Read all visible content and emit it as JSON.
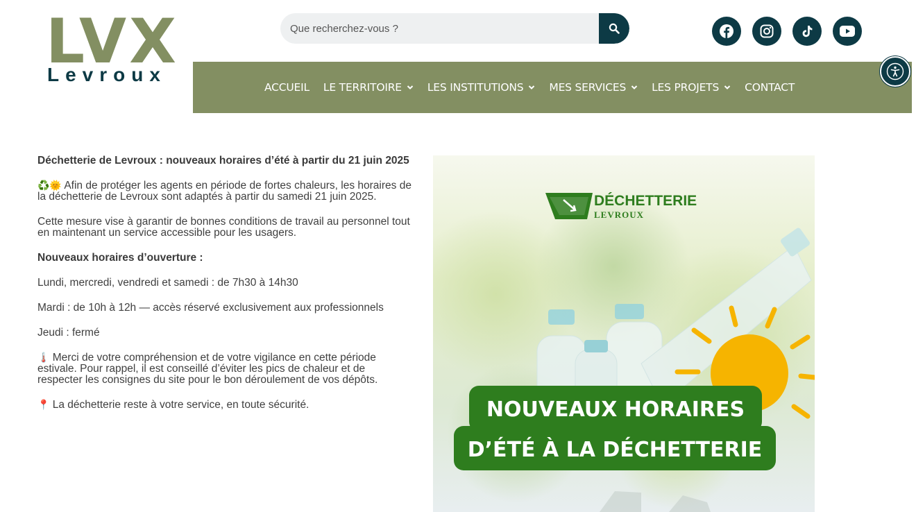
{
  "logo": {
    "big": "LVX",
    "small": "Levroux"
  },
  "search": {
    "placeholder": "Que recherchez-vous ?"
  },
  "social": [
    "facebook-icon",
    "instagram-icon",
    "tiktok-icon",
    "youtube-icon"
  ],
  "nav": {
    "items": [
      {
        "label": "ACCUEIL",
        "dropdown": false
      },
      {
        "label": "LE TERRITOIRE",
        "dropdown": true
      },
      {
        "label": "LES INSTITUTIONS",
        "dropdown": true
      },
      {
        "label": "MES SERVICES",
        "dropdown": true
      },
      {
        "label": "LES PROJETS",
        "dropdown": true
      },
      {
        "label": "CONTACT",
        "dropdown": false
      }
    ]
  },
  "article": {
    "title": "Déchetterie de Levroux : nouveaux horaires d’été à partir du 21 juin 2025",
    "p1_emoji": "♻️🌞",
    "p1": "Afin de protéger les agents en période de fortes chaleurs, les horaires de la déchetterie de Levroux sont adaptés à partir du samedi 21 juin 2025.",
    "p2": "Cette mesure vise à garantir de bonnes conditions de travail au personnel tout en maintenant un service accessible pour les usagers.",
    "hours_title": "Nouveaux horaires d’ouverture :",
    "hours1": "Lundi, mercredi, vendredi et samedi : de 7h30 à 14h30",
    "hours2": "Mardi : de 10h à 12h — accès réservé exclusivement aux professionnels",
    "hours3": "Jeudi : fermé",
    "p3_emoji": "🌡️",
    "p3": "Merci de votre compréhension et de votre vigilance en cette période estivale. Pour rappel, il est conseillé d’éviter les pics de chaleur et de respecter les consignes du site pour le bon déroulement de vos dépôts.",
    "p4_emoji": "📍",
    "p4": "La déchetterie reste à votre service, en toute sécurité."
  },
  "image": {
    "brand": "DÉCHETTERIE",
    "brand_sub": "LEVROUX",
    "banner_line1": "NOUVEAUX HORAIRES",
    "banner_line2": "D’ÉTÉ À LA DÉCHETTERIE"
  },
  "colors": {
    "olive": "#838f62",
    "dark_teal": "#0d3a45",
    "green": "#2e7d1e",
    "sun": "#f6b400"
  }
}
